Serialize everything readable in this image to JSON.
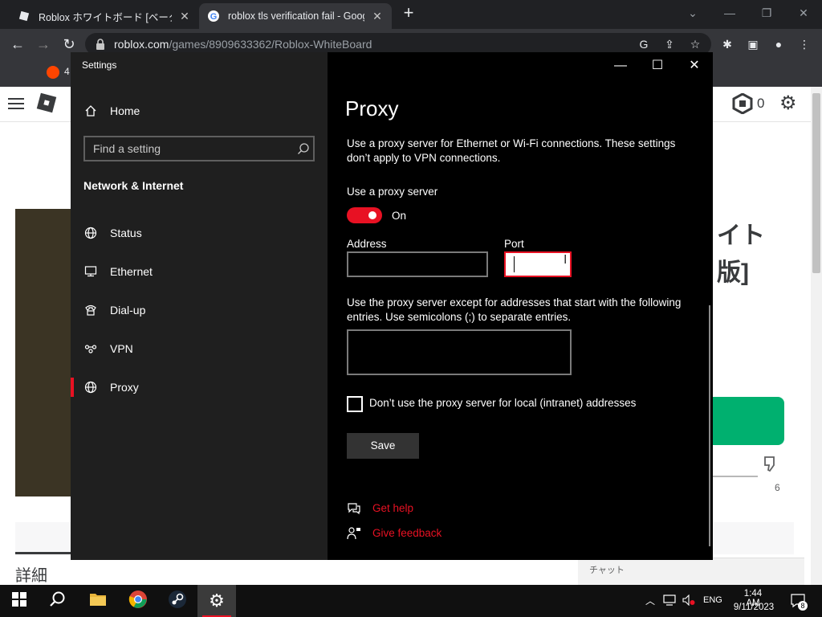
{
  "browser": {
    "tabs": [
      {
        "label": "Roblox ホワイトボード [ベータ版] - Ro",
        "active": false
      },
      {
        "label": "roblox tls verification fail - Googl",
        "active": true
      }
    ],
    "new_tab": "+",
    "url_host": "roblox.com",
    "url_path": "/games/8909633362/Roblox-WhiteBoard",
    "bookmark_count": "4"
  },
  "roblox_page": {
    "robux": "0",
    "title_line1": "イト",
    "title_line2": "版]",
    "dislike_count": "6",
    "details_heading": "詳細",
    "chat_label": "チャット"
  },
  "settings": {
    "window_title": "Settings",
    "home": "Home",
    "search_placeholder": "Find a setting",
    "section_heading": "Network & Internet",
    "nav_items": [
      {
        "label": "Status",
        "icon": "globe-icon"
      },
      {
        "label": "Ethernet",
        "icon": "ethernet-icon"
      },
      {
        "label": "Dial-up",
        "icon": "dialup-icon"
      },
      {
        "label": "VPN",
        "icon": "vpn-icon"
      },
      {
        "label": "Proxy",
        "icon": "globe-icon",
        "selected": true
      }
    ],
    "page_title": "Proxy",
    "description": "Use a proxy server for Ethernet or Wi-Fi connections. These settings don’t apply to VPN connections.",
    "use_proxy_label": "Use a proxy server",
    "toggle_state": "On",
    "address_label": "Address",
    "address_value": "",
    "port_label": "Port",
    "port_value": "",
    "exceptions_label": "Use the proxy server except for addresses that start with the following entries. Use semicolons (;) to separate entries.",
    "exceptions_value": "",
    "local_checkbox_label": "Don’t use the proxy server for local (intranet) addresses",
    "local_checked": false,
    "save_label": "Save",
    "help_link": "Get help",
    "feedback_link": "Give feedback",
    "accent_color": "#e81123"
  },
  "taskbar": {
    "language": "ENG",
    "time": "1:44 AM",
    "date": "9/11/2023",
    "notification_count": "8"
  }
}
